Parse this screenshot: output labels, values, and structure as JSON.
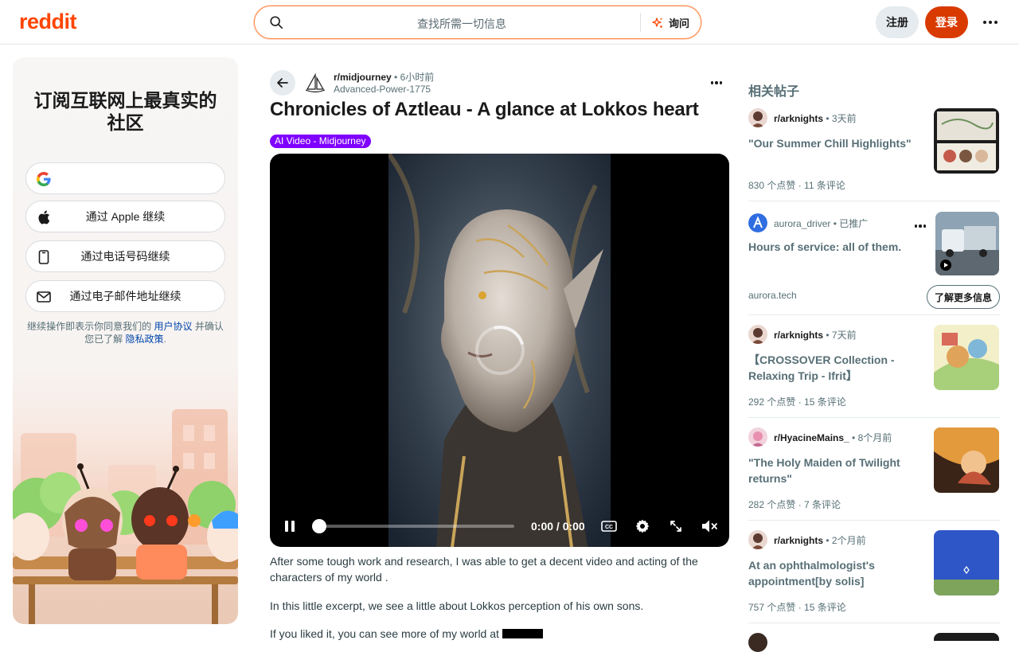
{
  "header": {
    "logo": "reddit",
    "search_placeholder": "查找所需一切信息",
    "ask_label": "询问",
    "signup_label": "注册",
    "login_label": "登录"
  },
  "login_card": {
    "title": "订阅互联网上最真实的社区",
    "apple_label": "通过 Apple 继续",
    "phone_label": "通过电话号码继续",
    "email_label": "通过电子邮件地址继续",
    "terms_prefix": "继续操作即表示你同意我们的 ",
    "terms_link": "用户协议",
    "terms_mid": " 并确认您已了解 ",
    "privacy_link": "隐私政策",
    "terms_suffix": "."
  },
  "post": {
    "subreddit": "r/midjourney",
    "age": "6小时前",
    "author": "Advanced-Power-1775",
    "title": "Chronicles of Aztleau - A glance at Lokkos heart",
    "flair": "AI Video - Midjourney",
    "video_time": "0:00 / 0:00",
    "video_progress": 0,
    "body": [
      "After some tough work and research, I was able to get a decent video and acting of the characters of my world .",
      "In this little excerpt, we see a little about Lokkos perception of his own sons.",
      "If you liked it, you can see more of my world at"
    ]
  },
  "related": {
    "heading": "相关帖子",
    "posts": [
      {
        "sub": "r/arknights",
        "age": "3天前",
        "title": "\"Our Summer Chill Highlights\"",
        "votes": "830 个点赞",
        "comments": "11 条评论"
      },
      {
        "sub": "aurora_driver",
        "age": "已推广",
        "title": "Hours of service: all of them.",
        "domain": "aurora.tech",
        "cta": "了解更多信息"
      },
      {
        "sub": "r/arknights",
        "age": "7天前",
        "title": "【CROSSOVER Collection - Relaxing Trip - Ifrit】",
        "votes": "292 个点赞",
        "comments": "15 条评论"
      },
      {
        "sub": "r/HyacineMains_",
        "age": "8个月前",
        "title": "\"The Holy Maiden of Twilight returns\"",
        "votes": "282 个点赞",
        "comments": "7 条评论"
      },
      {
        "sub": "r/arknights",
        "age": "2个月前",
        "title": "At an ophthalmologist's appointment[by solis]",
        "votes": "757 个点赞",
        "comments": "15 条评论"
      }
    ]
  },
  "colors": {
    "brand": "#ff4500",
    "login_button": "#d93a00",
    "flair": "#7f00ff",
    "link": "#0045ac"
  },
  "icons": [
    "search-icon",
    "ask-sparkle-icon",
    "more-icon",
    "google-icon",
    "apple-icon",
    "phone-icon",
    "mail-icon",
    "back-arrow-icon",
    "pause-icon",
    "captions-icon",
    "settings-icon",
    "fullscreen-icon",
    "muted-icon",
    "play-icon"
  ]
}
